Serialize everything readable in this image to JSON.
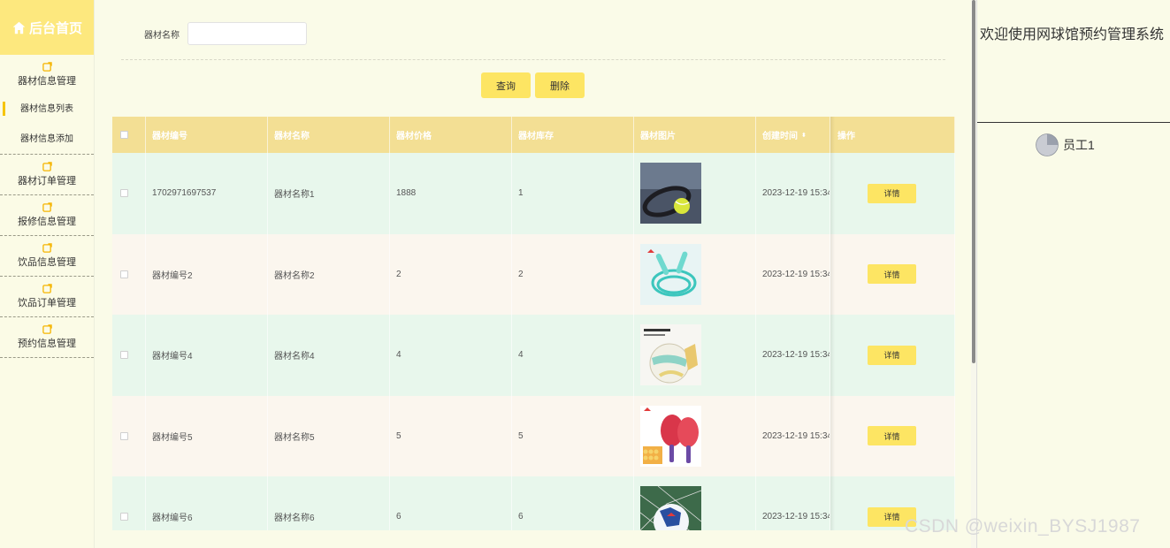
{
  "sidebar": {
    "brand": "后台首页",
    "groups": [
      {
        "label": "器材信息管理",
        "items": [
          "器材信息列表",
          "器材信息添加"
        ]
      },
      {
        "label": "器材订单管理"
      },
      {
        "label": "报修信息管理"
      },
      {
        "label": "饮品信息管理"
      },
      {
        "label": "饮品订单管理"
      },
      {
        "label": "预约信息管理"
      }
    ]
  },
  "search": {
    "label": "器材名称",
    "value": "",
    "placeholder": ""
  },
  "buttons": {
    "query": "查询",
    "delete": "删除"
  },
  "table": {
    "headers": [
      "器材编号",
      "器材名称",
      "器材价格",
      "器材库存",
      "器材图片",
      "创建时间",
      "操作"
    ],
    "rows": [
      {
        "code": "1702971697537",
        "name": "器材名称1",
        "price": "1888",
        "stock": "1",
        "created": "2023-12-19 15:34",
        "action": "详情"
      },
      {
        "code": "器材编号2",
        "name": "器材名称2",
        "price": "2",
        "stock": "2",
        "created": "2023-12-19 15:34",
        "action": "详情"
      },
      {
        "code": "器材编号4",
        "name": "器材名称4",
        "price": "4",
        "stock": "4",
        "created": "2023-12-19 15:34",
        "action": "详情"
      },
      {
        "code": "器材编号5",
        "name": "器材名称5",
        "price": "5",
        "stock": "5",
        "created": "2023-12-19 15:34",
        "action": "详情"
      },
      {
        "code": "器材编号6",
        "name": "器材名称6",
        "price": "6",
        "stock": "6",
        "created": "2023-12-19 15:34",
        "action": "详情"
      }
    ]
  },
  "right_panel": {
    "welcome": "欢迎使用网球馆预约管理系统",
    "user": "员工1"
  },
  "watermark": "CSDN @weixin_BYSJ1987",
  "colors": {
    "brand": "#fde87e",
    "button": "#fde563",
    "header": "#f3df94",
    "row_green": "#e8f7ec",
    "row_cream": "#fbf6ee"
  }
}
